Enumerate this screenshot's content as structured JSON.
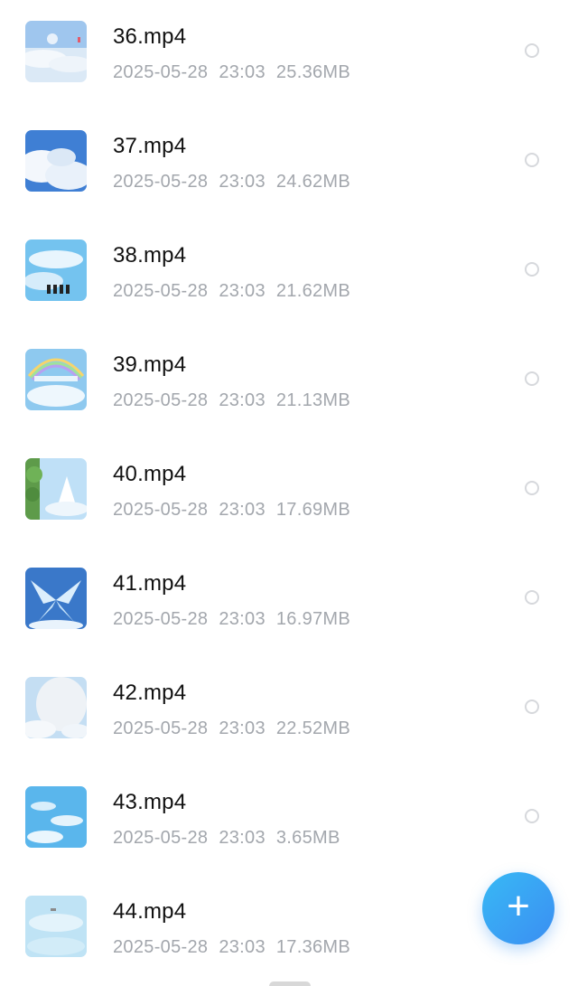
{
  "files": [
    {
      "name": "36.mp4",
      "date": "2025-05-28",
      "time": "23:03",
      "size": "25.36MB"
    },
    {
      "name": "37.mp4",
      "date": "2025-05-28",
      "time": "23:03",
      "size": "24.62MB"
    },
    {
      "name": "38.mp4",
      "date": "2025-05-28",
      "time": "23:03",
      "size": "21.62MB"
    },
    {
      "name": "39.mp4",
      "date": "2025-05-28",
      "time": "23:03",
      "size": "21.13MB"
    },
    {
      "name": "40.mp4",
      "date": "2025-05-28",
      "time": "23:03",
      "size": "17.69MB"
    },
    {
      "name": "41.mp4",
      "date": "2025-05-28",
      "time": "23:03",
      "size": "16.97MB"
    },
    {
      "name": "42.mp4",
      "date": "2025-05-28",
      "time": "23:03",
      "size": "22.52MB"
    },
    {
      "name": "43.mp4",
      "date": "2025-05-28",
      "time": "23:03",
      "size": "3.65MB"
    },
    {
      "name": "44.mp4",
      "date": "2025-05-28",
      "time": "23:03",
      "size": "17.36MB"
    }
  ],
  "fab": {
    "icon": "plus-icon",
    "glyph": "+"
  },
  "colors": {
    "accent": "#3b8ef2",
    "meta_text": "#a3a7ad",
    "name_text": "#111111",
    "radio_border": "#d6d8dc"
  }
}
